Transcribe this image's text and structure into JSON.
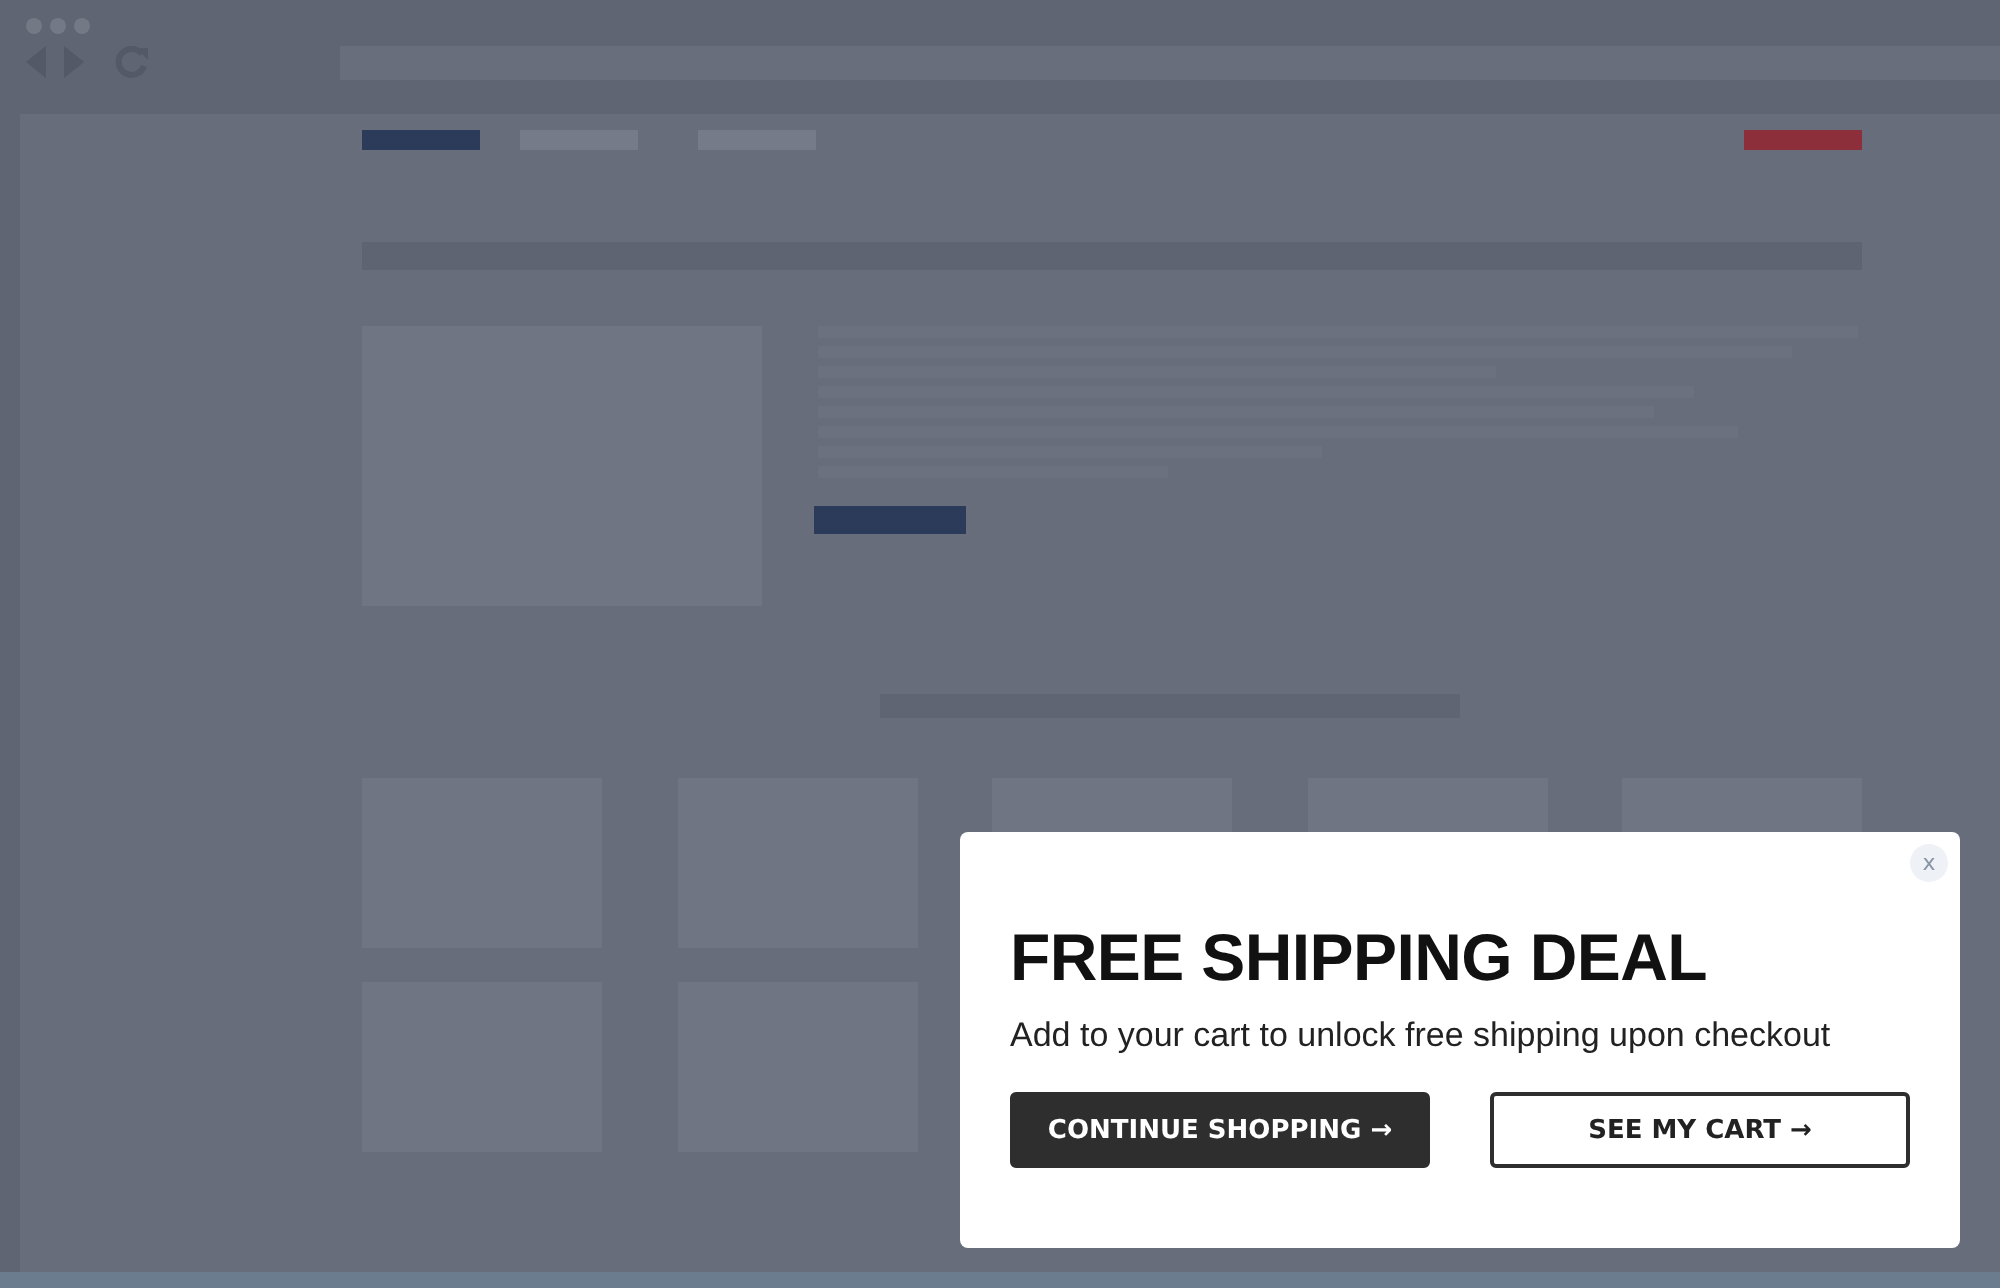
{
  "popup": {
    "close": "x",
    "title": "FREE SHIPPING DEAL",
    "message": "Add to your cart to unlock free shipping upon checkout",
    "buttons": [
      {
        "label": "CONTINUE SHOPPING →",
        "kind": "primary"
      },
      {
        "label": "SEE MY CART →",
        "kind": "outline"
      }
    ]
  }
}
